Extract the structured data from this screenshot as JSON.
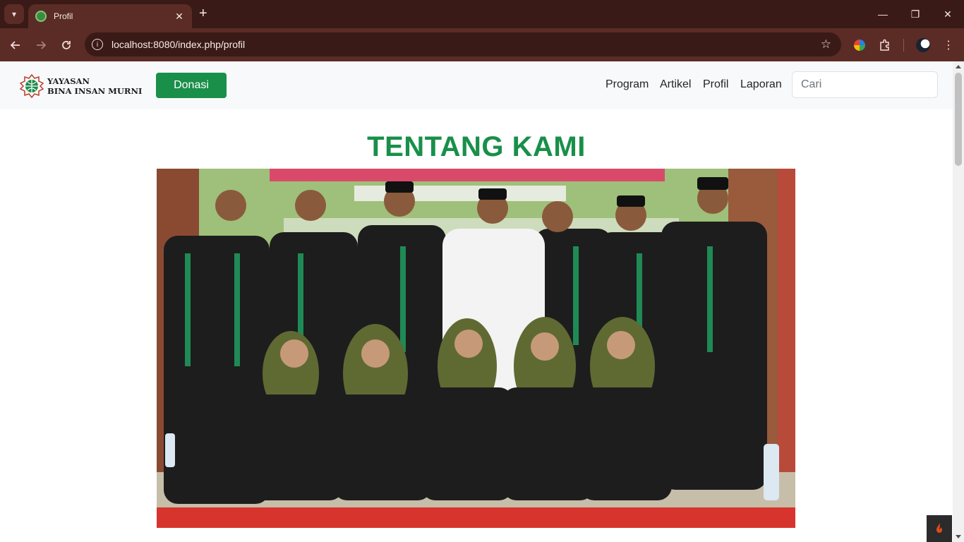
{
  "browser": {
    "tab_title": "Profil",
    "tab_close": "✕",
    "new_tab": "+",
    "url": "localhost:8080/index.php/profil",
    "window_controls": {
      "minimize": "—",
      "restore": "❐",
      "close": "✕"
    }
  },
  "navbar": {
    "logo_line1": "YAYASAN",
    "logo_line2": "BINA INSAN MURNI",
    "donate_label": "Donasi",
    "menu": [
      "Program",
      "Artikel",
      "Profil",
      "Laporan"
    ],
    "search_placeholder": "Cari"
  },
  "main": {
    "heading": "TENTANG KAMI",
    "photo_icon": "group-photo"
  },
  "colors": {
    "brand_green": "#198f4a",
    "chrome_dark": "#3a1a16",
    "chrome_mid": "#5a2c25",
    "navbar_bg": "#f8f9fa"
  }
}
